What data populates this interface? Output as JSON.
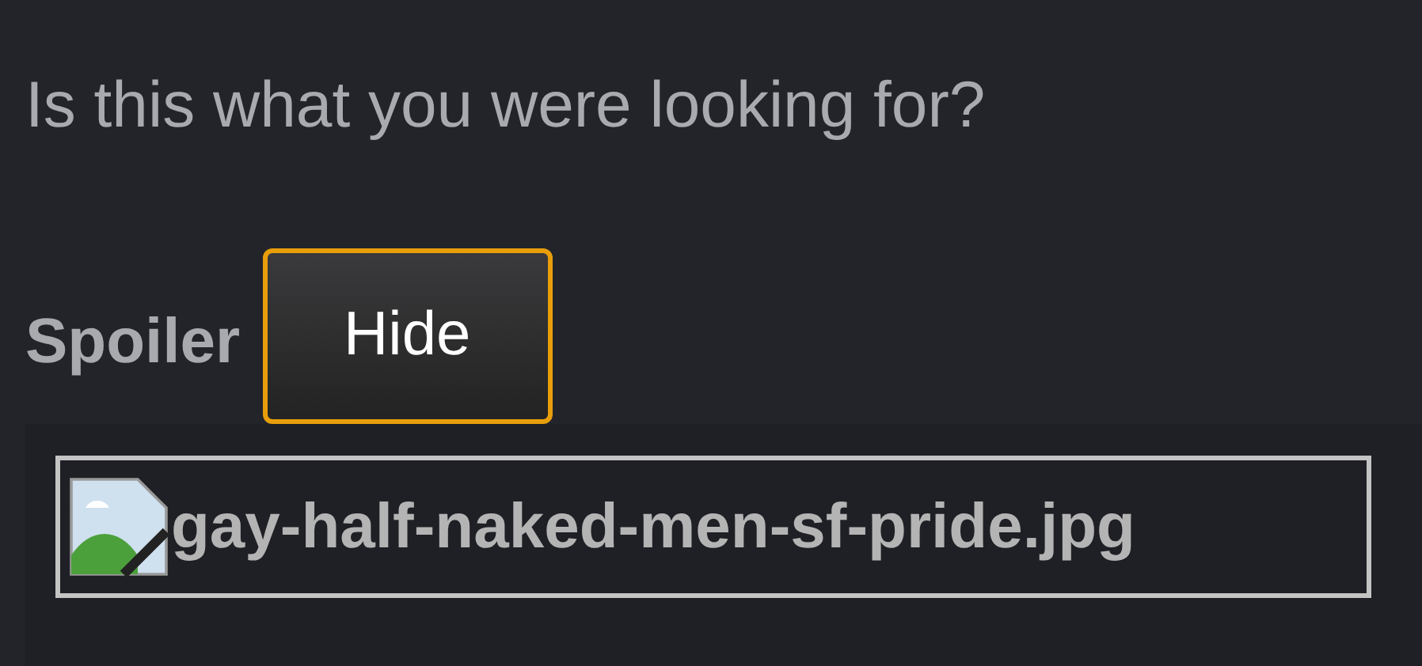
{
  "question": "Is this what you were looking for?",
  "spoiler": {
    "label": "Spoiler",
    "button": {
      "label": "Hide",
      "focused": true
    },
    "image": {
      "filename": "gay-half-naked-men-sf-pride.jpg"
    }
  }
}
